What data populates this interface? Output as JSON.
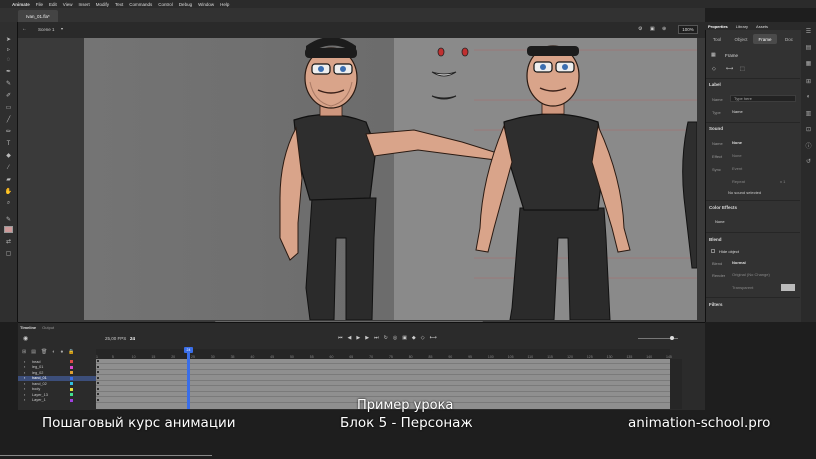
{
  "menubar": {
    "apple": "",
    "items": [
      "Animate",
      "File",
      "Edit",
      "View",
      "Insert",
      "Modify",
      "Text",
      "Commands",
      "Control",
      "Debug",
      "Window",
      "Help"
    ]
  },
  "document": {
    "tab_label": "Ivan_01.fla*"
  },
  "editbar": {
    "scene": "Scene 1",
    "zoom": "100%"
  },
  "properties": {
    "panel_tabs": [
      "Properties",
      "Library",
      "Assets"
    ],
    "sub_tabs": [
      "Tool",
      "Object",
      "Frame",
      "Doc"
    ],
    "active_sub_tab": "Frame",
    "frame_label": "Frame",
    "label_section": "Label",
    "name_label": "Name",
    "name_placeholder": "Type here",
    "type_label": "Type",
    "type_value": "Name",
    "sound_section": "Sound",
    "sound_name_label": "Name",
    "sound_name_value": "None",
    "effect_label": "Effect",
    "effect_value": "None",
    "sync_label": "Sync",
    "sync_value": "Event",
    "repeat_value": "Repeat",
    "repeat_count": "x 1",
    "no_sound": "No sound selected",
    "color_effects_section": "Color Effects",
    "color_value": "None",
    "blend_section": "Blend",
    "hide_object": "Hide object",
    "blend_label": "Blend",
    "blend_value": "Normal",
    "render_label": "Render",
    "render_value": "Original (No Change)",
    "transparent_value": "Transparent",
    "filters_section": "Filters"
  },
  "timeline": {
    "tabs": [
      "Timeline",
      "Output"
    ],
    "fps": "25,00 FPS",
    "frame": "24",
    "ruler_ticks": [
      "1",
      "5",
      "10",
      "15",
      "20",
      "25",
      "30",
      "35",
      "40",
      "45",
      "50",
      "55",
      "60",
      "65",
      "70",
      "75",
      "80",
      "85",
      "90",
      "95",
      "100",
      "105",
      "110",
      "115",
      "120",
      "125",
      "130",
      "135",
      "140",
      "145"
    ],
    "playhead_label": "24",
    "layers": [
      {
        "name": "head",
        "color": "#e04a4a",
        "selected": false
      },
      {
        "name": "leg_01",
        "color": "#e04ad0",
        "selected": false
      },
      {
        "name": "leg_02",
        "color": "#e0a030",
        "selected": false
      },
      {
        "name": "hand_01",
        "color": "#3a6ee8",
        "selected": true
      },
      {
        "name": "hand_02",
        "color": "#30c0e0",
        "selected": false
      },
      {
        "name": "body",
        "color": "#e0e040",
        "selected": false
      },
      {
        "name": "Layer_13",
        "color": "#40e090",
        "selected": false
      },
      {
        "name": "Layer_1",
        "color": "#a040e0",
        "selected": false
      }
    ]
  },
  "captions": {
    "lesson_title": "Пример урока",
    "course": "Пошаговый курс анимации",
    "block": "Блок 5 - Персонаж",
    "website": "animation-school.pro"
  }
}
